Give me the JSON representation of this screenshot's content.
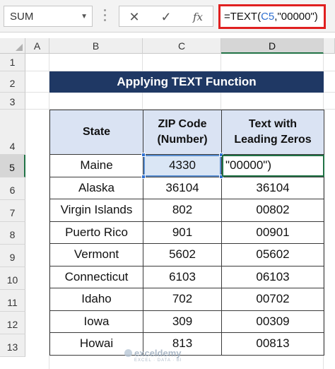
{
  "formula_bar": {
    "name_box": "SUM",
    "cancel_icon": "✕",
    "enter_icon": "✓",
    "fx_label": "fx",
    "formula_prefix": "=TEXT(",
    "formula_ref": "C5",
    "formula_suffix": ",\"00000\")"
  },
  "columns": [
    "A",
    "B",
    "C",
    "D"
  ],
  "rows": [
    "1",
    "2",
    "3",
    "4",
    "5",
    "6",
    "7",
    "8",
    "9",
    "10",
    "11",
    "12",
    "13"
  ],
  "title": "Applying TEXT Function",
  "table": {
    "headers": {
      "state": "State",
      "zip_line1": "ZIP Code",
      "zip_line2": "(Number)",
      "text_line1": "Text with",
      "text_line2": "Leading Zeros"
    },
    "rows": [
      {
        "state": "Maine",
        "zip": "4330",
        "text": "\"00000\")"
      },
      {
        "state": "Alaska",
        "zip": "36104",
        "text": "36104"
      },
      {
        "state": "Virgin Islands",
        "zip": "802",
        "text": "00802"
      },
      {
        "state": "Puerto Rico",
        "zip": "901",
        "text": "00901"
      },
      {
        "state": "Vermont",
        "zip": "5602",
        "text": "05602"
      },
      {
        "state": "Connecticut",
        "zip": "6103",
        "text": "06103"
      },
      {
        "state": "Idaho",
        "zip": "702",
        "text": "00702"
      },
      {
        "state": "Iowa",
        "zip": "309",
        "text": "00309"
      },
      {
        "state": "Howai",
        "zip": "813",
        "text": "00813"
      }
    ]
  },
  "colors": {
    "header_fill": "#dae3f3",
    "title_fill": "#1f3864",
    "formula_border": "#e02020",
    "selection": "#217346"
  },
  "watermark": {
    "name": "exceldemy",
    "tagline": "EXCEL · DATA · BI"
  }
}
